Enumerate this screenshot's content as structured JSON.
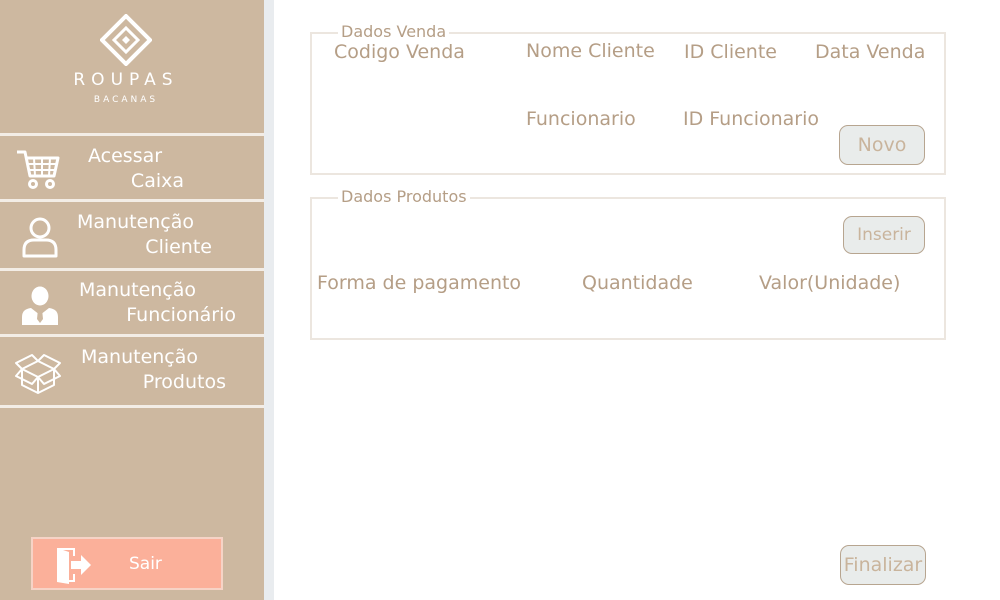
{
  "sidebar": {
    "logo_title": "ROUPAS",
    "logo_subtitle": "BACANAS",
    "items": [
      {
        "line1": "Acessar",
        "line2": "Caixa",
        "icon": "cart-icon"
      },
      {
        "line1": "Manutenção",
        "line2": "Cliente",
        "icon": "user-outline-icon"
      },
      {
        "line1": "Manutenção",
        "line2": "Funcionário",
        "icon": "employee-icon"
      },
      {
        "line1": "Manutenção",
        "line2": "Produtos",
        "icon": "box-icon"
      }
    ],
    "exit_label": "Sair"
  },
  "venda": {
    "legend": "Dados Venda",
    "codigo_label": "Codigo Venda",
    "nome_cliente_label": "Nome Cliente",
    "id_cliente_label": "ID Cliente",
    "data_label": "Data Venda",
    "funcionario_label": "Funcionario",
    "id_funcionario_label": "ID Funcionario",
    "novo_label": "Novo"
  },
  "produtos": {
    "legend": "Dados Produtos",
    "inserir_label": "Inserir",
    "pagamento_label": "Forma de pagamento",
    "quantidade_label": "Quantidade",
    "valor_label": "Valor(Unidade)"
  },
  "finalizar_label": "Finalizar",
  "colors": {
    "sidebar_bg": "#cdb8a0",
    "accent_text": "#b59e86",
    "exit_button": "#fbb09a"
  }
}
